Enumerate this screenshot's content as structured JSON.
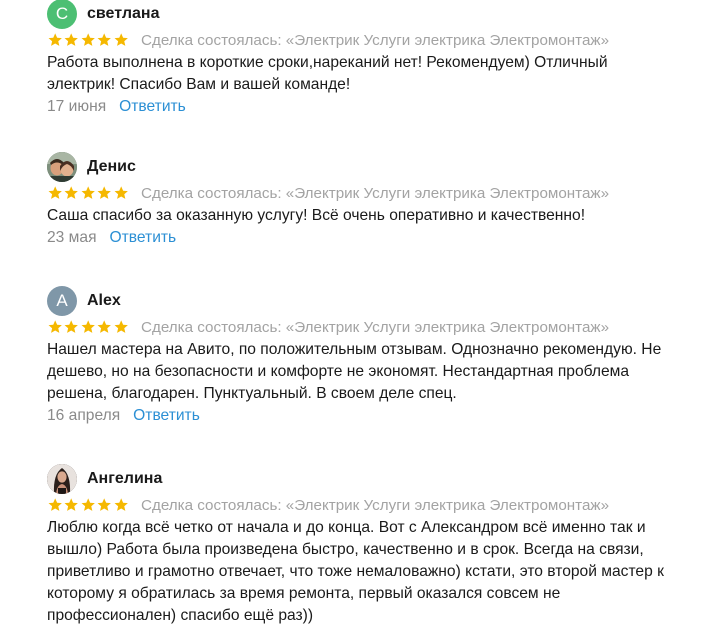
{
  "reviews": [
    {
      "author": "светлана",
      "avatar_letter": "С",
      "avatar_color": "#4cbf73",
      "rating": 5,
      "deal": "Сделка состоялась: «Электрик Услуги электрика Электромонтаж»",
      "text": "Работа выполнена в короткие сроки,нареканий нет! Рекомендуем) Отличный электрик! Спасибо Вам и вашей команде!",
      "date": "17 июня",
      "reply_label": "Ответить"
    },
    {
      "author": "Денис",
      "avatar_type": "photo",
      "rating": 5,
      "deal": "Сделка состоялась: «Электрик Услуги электрика Электромонтаж»",
      "text": "Саша спасибо за оказанную услугу! Всё очень оперативно и качественно!",
      "date": "23 мая",
      "reply_label": "Ответить"
    },
    {
      "author": "Alex",
      "avatar_letter": "A",
      "avatar_color": "#7f97a8",
      "rating": 5,
      "deal": "Сделка состоялась: «Электрик Услуги электрика Электромонтаж»",
      "text": "Нашел мастера на Авито, по положительным отзывам. Однозначно рекомендую. Не дешево, но на безопасности и комфорте не экономят. Нестандартная проблема решена, благодарен. Пунктуальный. В своем деле спец.",
      "date": "16 апреля",
      "reply_label": "Ответить"
    },
    {
      "author": "Ангелина",
      "avatar_type": "photo",
      "rating": 5,
      "deal": "Сделка состоялась: «Электрик Услуги электрика Электромонтаж»",
      "text": "Люблю когда всё четко от начала и до конца. Вот с Александром всё именно так и вышло) Работа была произведена быстро, качественно и в срок. Всегда на связи, приветливо и грамотно отвечает, что тоже немаловажно) кстати, это второй мастер к которому я обратилась за время ремонта, первый оказался совсем не профессионален) спасибо ещё раз))"
    }
  ],
  "colors": {
    "star": "#f5b800",
    "deal_text": "#a3a3a3",
    "date_text": "#8a8a8a",
    "reply_link": "#2b8fd4"
  }
}
